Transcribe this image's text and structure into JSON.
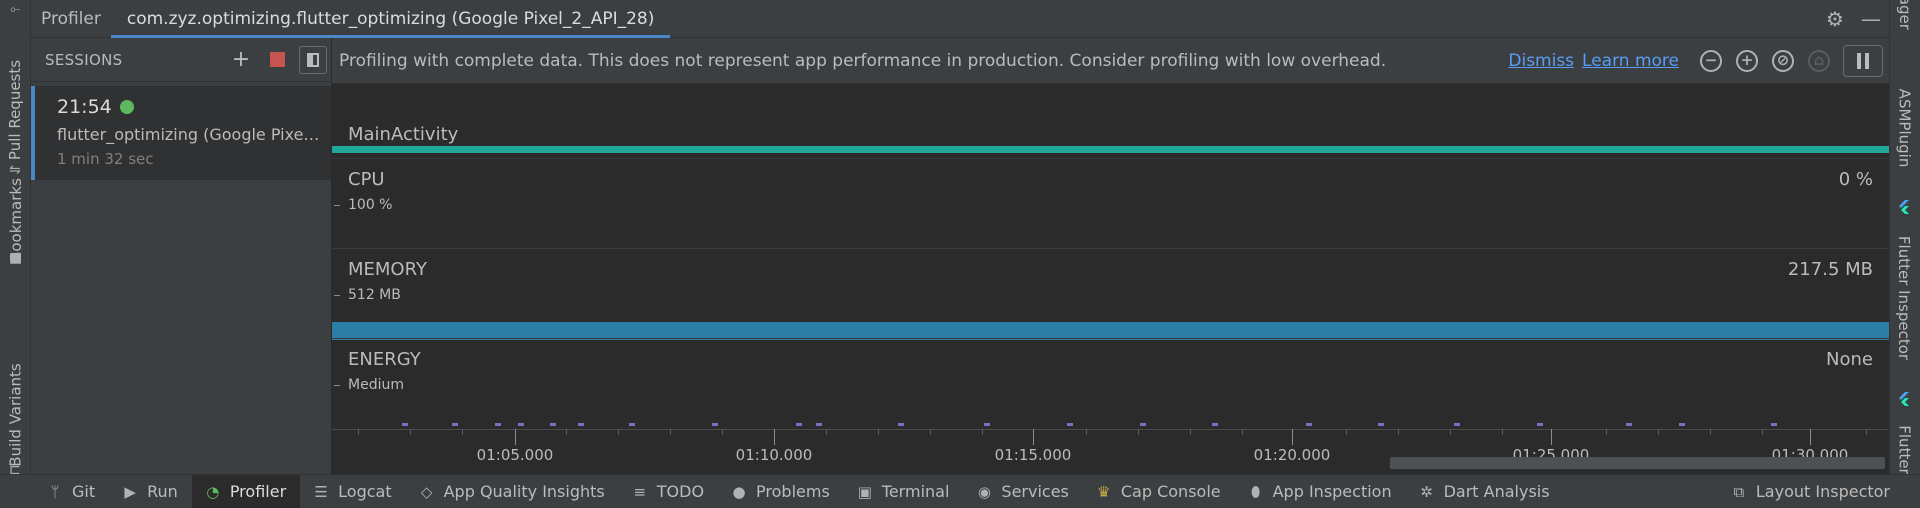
{
  "titlebar": {
    "title": "Profiler",
    "device_tab": "com.zyz.optimizing.flutter_optimizing (Google Pixel_2_API_28)",
    "icons": [
      "gear-icon",
      "minimize-icon"
    ]
  },
  "left_strip": {
    "items": [
      {
        "label": "Pull Requests",
        "icon": "pull-request-icon"
      },
      {
        "label": "Bookmarks",
        "icon": "bookmark-icon"
      },
      {
        "label": "Build Variants",
        "icon": "build-variants-icon"
      }
    ]
  },
  "right_strip": {
    "items": [
      {
        "label": "ASMPlugin"
      },
      {
        "label": "Flutter Inspector",
        "icon": "flutter-icon"
      },
      {
        "label": "Flutter",
        "icon": "flutter-icon"
      }
    ]
  },
  "sessions": {
    "header": "SESSIONS",
    "add_symbol": "+",
    "items": [
      {
        "time": "21:54",
        "name": "flutter_optimizing (Google Pixel_2_API_28)",
        "duration": "1 min 32 sec",
        "live": true
      }
    ]
  },
  "banner": {
    "message": "Profiling with complete data. This does not represent app performance in production. Consider profiling with low overhead.",
    "dismiss": "Dismiss",
    "learn_more": "Learn more",
    "zoom_out_symbol": "−",
    "zoom_in_symbol": "+",
    "reset_zoom_symbol": "⊘",
    "attach_symbol": "⌂"
  },
  "activity": {
    "label": "MainActivity"
  },
  "monitors": {
    "cpu": {
      "title": "CPU",
      "scale": "100 %",
      "value": "0 %"
    },
    "memory": {
      "title": "MEMORY",
      "scale": "512 MB",
      "value": "217.5 MB"
    },
    "energy": {
      "title": "ENERGY",
      "scale": "Medium",
      "value": "None"
    }
  },
  "timeline": {
    "labels": [
      "01:05.000",
      "01:10.000",
      "01:15.000",
      "01:20.000",
      "01:25.000",
      "01:30.000"
    ]
  },
  "bottombar": {
    "items": [
      {
        "label": "Git",
        "icon": "git-branch-icon"
      },
      {
        "label": "Run",
        "icon": "run-icon"
      },
      {
        "label": "Profiler",
        "icon": "profiler-icon",
        "active": true
      },
      {
        "label": "Logcat",
        "icon": "logcat-icon"
      },
      {
        "label": "App Quality Insights",
        "icon": "app-quality-icon"
      },
      {
        "label": "TODO",
        "icon": "todo-icon"
      },
      {
        "label": "Problems",
        "icon": "problems-icon"
      },
      {
        "label": "Terminal",
        "icon": "terminal-icon"
      },
      {
        "label": "Services",
        "icon": "services-icon"
      },
      {
        "label": "Cap Console",
        "icon": "cap-console-icon"
      },
      {
        "label": "App Inspection",
        "icon": "app-inspection-icon"
      },
      {
        "label": "Dart Analysis",
        "icon": "dart-analysis-icon"
      },
      {
        "label": "Layout Inspector",
        "icon": "layout-inspector-icon"
      }
    ]
  },
  "colors": {
    "activity_bar": "#20a89a",
    "memory_bar": "#2d7ea6",
    "accent": "#4a88c7",
    "link": "#589df6",
    "live_dot": "#5fb85f",
    "stop": "#c75450",
    "event_marks": "#7b6fc5"
  }
}
